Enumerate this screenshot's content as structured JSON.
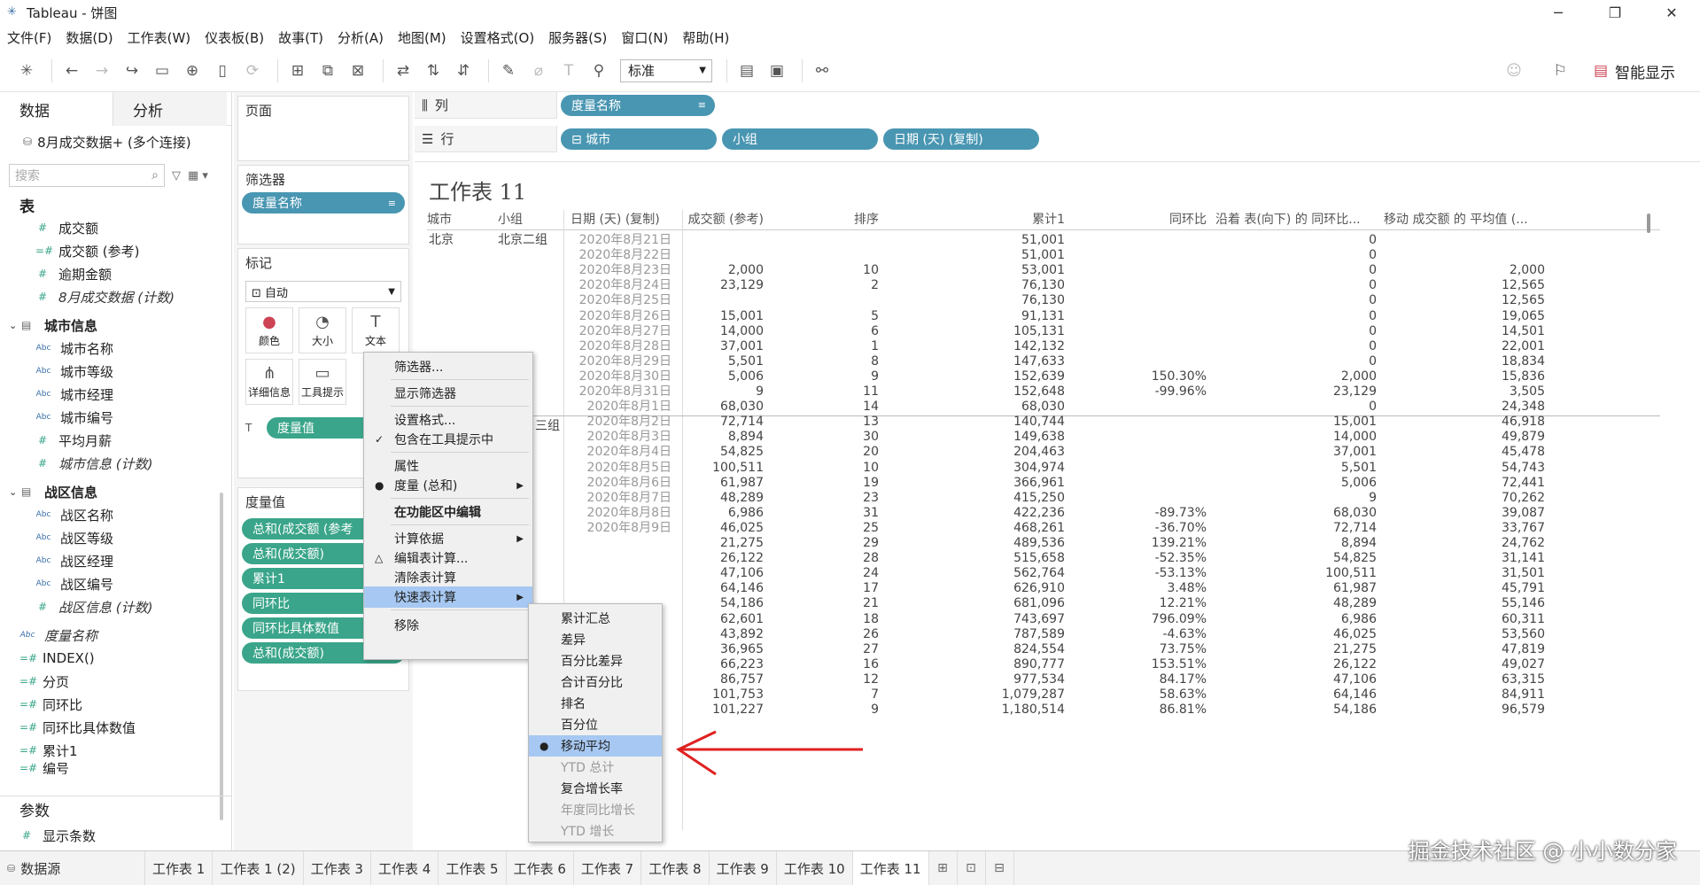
{
  "window": {
    "title": "Tableau - 饼图",
    "controls": [
      "─",
      "❐",
      "✕"
    ]
  },
  "menu": [
    "文件(F)",
    "数据(D)",
    "工作表(W)",
    "仪表板(B)",
    "故事(T)",
    "分析(A)",
    "地图(M)",
    "设置格式(O)",
    "服务器(S)",
    "窗口(N)",
    "帮助(H)"
  ],
  "toolbar": {
    "view_size": "标准",
    "smart_show": "智能显示"
  },
  "data_pane": {
    "tab_data": "数据",
    "tab_analysis": "分析",
    "connection": "8月成交数据+ (多个连接)",
    "search_placeholder": "搜索",
    "table_head": "表",
    "table_fields": [
      "成交额",
      "成交额 (参考)",
      "逾期金额",
      "8月成交数据 (计数)"
    ],
    "group1": {
      "name": "城市信息",
      "fields": [
        "城市名称",
        "城市等级",
        "城市经理",
        "城市编号"
      ],
      "measures": [
        "平均月薪",
        "城市信息 (计数)"
      ]
    },
    "group2": {
      "name": "战区信息",
      "fields": [
        "战区名称",
        "战区等级",
        "战区经理",
        "战区编号"
      ],
      "measures": [
        "战区信息 (计数)"
      ]
    },
    "extra_fields": [
      "度量名称",
      "INDEX()",
      "分页",
      "同环比",
      "同环比具体数值",
      "累计1",
      "编号"
    ],
    "params_head": "参数",
    "params": [
      "显示条数"
    ]
  },
  "shelves": {
    "pages": "页面",
    "filters": "筛选器",
    "filter_pill": "度量名称",
    "marks": "标记",
    "marks_type": "自动",
    "mark_color": "颜色",
    "mark_size": "大小",
    "mark_text": "文本",
    "mark_detail": "详细信息",
    "mark_tooltip": "工具提示",
    "marks_pill": "度量值",
    "measure_values": "度量值",
    "measure_pills": [
      "总和(成交额 (参考",
      "总和(成交额)",
      "累计1",
      "同环比",
      "同环比具体数值",
      "总和(成交额)"
    ]
  },
  "columns_shelf": {
    "label": "列",
    "pills": [
      "度量名称"
    ]
  },
  "rows_shelf": {
    "label": "行",
    "pills": [
      "⊟ 城市",
      "小组",
      "日期 (天) (复制)"
    ]
  },
  "sheet": {
    "title": "工作表 11",
    "headers": [
      "城市",
      "小组",
      "日期 (天) (复制)",
      "成交额 (参考)",
      "排序",
      "累计1",
      "同环比",
      "沿着 表(向下) 的 同环比...",
      "移动 成交额 的 平均值 (..."
    ],
    "city": "北京",
    "group_a": "北京二组",
    "group_b_partial": "三组",
    "rows": [
      [
        "2020年8月21日",
        "",
        "",
        "51,001",
        "",
        "0",
        ""
      ],
      [
        "2020年8月22日",
        "",
        "",
        "51,001",
        "",
        "0",
        ""
      ],
      [
        "2020年8月23日",
        "2,000",
        "10",
        "53,001",
        "",
        "0",
        "2,000"
      ],
      [
        "2020年8月24日",
        "23,129",
        "2",
        "76,130",
        "",
        "0",
        "12,565"
      ],
      [
        "2020年8月25日",
        "",
        "",
        "76,130",
        "",
        "0",
        "12,565"
      ],
      [
        "2020年8月26日",
        "15,001",
        "5",
        "91,131",
        "",
        "0",
        "19,065"
      ],
      [
        "2020年8月27日",
        "14,000",
        "6",
        "105,131",
        "",
        "0",
        "14,501"
      ],
      [
        "2020年8月28日",
        "37,001",
        "1",
        "142,132",
        "",
        "0",
        "22,001"
      ],
      [
        "2020年8月29日",
        "5,501",
        "8",
        "147,633",
        "",
        "0",
        "18,834"
      ],
      [
        "2020年8月30日",
        "5,006",
        "9",
        "152,639",
        "150.30%",
        "2,000",
        "15,836"
      ],
      [
        "2020年8月31日",
        "9",
        "11",
        "152,648",
        "-99.96%",
        "23,129",
        "3,505"
      ],
      [
        "2020年8月1日",
        "68,030",
        "14",
        "68,030",
        "",
        "0",
        "24,348"
      ],
      [
        "2020年8月2日",
        "72,714",
        "13",
        "140,744",
        "",
        "15,001",
        "46,918"
      ],
      [
        "2020年8月3日",
        "8,894",
        "30",
        "149,638",
        "",
        "14,000",
        "49,879"
      ],
      [
        "2020年8月4日",
        "54,825",
        "20",
        "204,463",
        "",
        "37,001",
        "45,478"
      ],
      [
        "2020年8月5日",
        "100,511",
        "10",
        "304,974",
        "",
        "5,501",
        "54,743"
      ],
      [
        "2020年8月6日",
        "61,987",
        "19",
        "366,961",
        "",
        "5,006",
        "72,441"
      ],
      [
        "2020年8月7日",
        "48,289",
        "23",
        "415,250",
        "",
        "9",
        "70,262"
      ],
      [
        "2020年8月8日",
        "6,986",
        "31",
        "422,236",
        "-89.73%",
        "68,030",
        "39,087"
      ],
      [
        "2020年8月9日",
        "46,025",
        "25",
        "468,261",
        "-36.70%",
        "72,714",
        "33,767"
      ],
      [
        "",
        "21,275",
        "29",
        "489,536",
        "139.21%",
        "8,894",
        "24,762"
      ],
      [
        "",
        "26,122",
        "28",
        "515,658",
        "-52.35%",
        "54,825",
        "31,141"
      ],
      [
        "",
        "47,106",
        "24",
        "562,764",
        "-53.13%",
        "100,511",
        "31,501"
      ],
      [
        "",
        "64,146",
        "17",
        "626,910",
        "3.48%",
        "61,987",
        "45,791"
      ],
      [
        "",
        "54,186",
        "21",
        "681,096",
        "12.21%",
        "48,289",
        "55,146"
      ],
      [
        "",
        "62,601",
        "18",
        "743,697",
        "796.09%",
        "6,986",
        "60,311"
      ],
      [
        "",
        "43,892",
        "26",
        "787,589",
        "-4.63%",
        "46,025",
        "53,560"
      ],
      [
        "",
        "36,965",
        "27",
        "824,554",
        "73.75%",
        "21,275",
        "47,819"
      ],
      [
        "",
        "66,223",
        "16",
        "890,777",
        "153.51%",
        "26,122",
        "49,027"
      ],
      [
        "",
        "86,757",
        "12",
        "977,534",
        "84.17%",
        "47,106",
        "63,315"
      ],
      [
        "",
        "101,753",
        "7",
        "1,079,287",
        "58.63%",
        "64,146",
        "84,911"
      ],
      [
        "",
        "101,227",
        "9",
        "1,180,514",
        "86.81%",
        "54,186",
        "96,579"
      ]
    ]
  },
  "context_menu": {
    "items": [
      "筛选器...",
      "显示筛选器",
      "设置格式...",
      "包含在工具提示中",
      "属性",
      "度量 (总和)",
      "在功能区中编辑",
      "计算依据",
      "编辑表计算...",
      "清除表计算",
      "快速表计算",
      "移除"
    ]
  },
  "submenu": {
    "items": [
      "累计汇总",
      "差异",
      "百分比差异",
      "合计百分比",
      "排名",
      "百分位",
      "移动平均",
      "YTD 总计",
      "复合增长率",
      "年度同比增长",
      "YTD 增长"
    ]
  },
  "bottom_tabs": {
    "datasource": "数据源",
    "sheets": [
      "工作表 1",
      "工作表 1 (2)",
      "工作表 3",
      "工作表 4",
      "工作表 5",
      "工作表 6",
      "工作表 7",
      "工作表 8",
      "工作表 9",
      "工作表 10",
      "工作表 11"
    ],
    "active": "工作表 11"
  },
  "watermark": "掘金技术社区 @ 小小数分家",
  "colors": {
    "green_pill": "#3aa58a",
    "blue_pill": "#4996b2",
    "menu_highlight": "#a6c8f2",
    "annotation_arrow": "#e02020"
  }
}
